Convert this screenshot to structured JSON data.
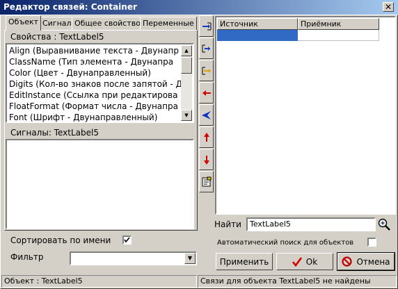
{
  "window": {
    "title": "Редактор связей: Container"
  },
  "tabs": [
    {
      "label": "Объект",
      "active": true
    },
    {
      "label": "Сигнал",
      "active": false
    },
    {
      "label": "Общее свойство",
      "active": false
    },
    {
      "label": "Переменные",
      "active": false
    }
  ],
  "properties": {
    "header": "Свойства : TextLabel5",
    "items": [
      "Align (Выравнивание текста - Двунапр",
      "ClassName (Тип элемента - Двунапра",
      "Color (Цвет - Двунаправленный)",
      "Digits (Кол-во знаков после запятой - Д",
      "EditInstance (Ссылка при редактирова",
      "FloatFormat (Формат числа - Двунапра",
      "Font (Шрифт - Двунаправленный)"
    ]
  },
  "signals": {
    "header": "Сигналы: TextLabel5"
  },
  "sort": {
    "label": "Сортировать по имени",
    "checked": true
  },
  "filter": {
    "label": "Фильтр",
    "value": ""
  },
  "grid": {
    "col_source": "Источник",
    "col_receiver": "Приёмник"
  },
  "search": {
    "label": "Найти",
    "value": "TextLabel5",
    "auto_label": "Автоматический поиск для объектов",
    "auto_checked": false
  },
  "buttons": {
    "apply": "Применить",
    "ok": "Ok",
    "cancel": "Отмена"
  },
  "status": {
    "left": "Объект : TextLabel5",
    "right": "Связи для объекта TextLabel5 не найдены"
  },
  "colors": {
    "accent": "#316ac5",
    "titlebar": "#0a246a",
    "ok_check": "#d40000",
    "cancel_icon": "#c00000"
  }
}
